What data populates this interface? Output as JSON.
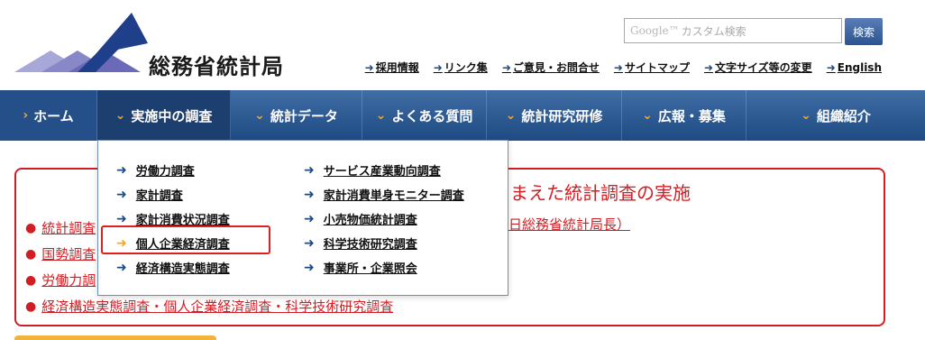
{
  "header": {
    "site_name": "総務省統計局",
    "search_placeholder_brand": "Google™",
    "search_placeholder": "カスタム検索",
    "search_button": "検索",
    "utility_links": [
      {
        "label": "採用情報",
        "icon": "arrow-right-icon"
      },
      {
        "label": "リンク集",
        "icon": "arrow-right-icon"
      },
      {
        "label": "ご意見・お問合せ",
        "icon": "arrow-right-icon"
      },
      {
        "label": "サイトマップ",
        "icon": "arrow-right-icon"
      },
      {
        "label": "文字サイズ等の変更",
        "icon": "arrow-right-icon"
      },
      {
        "label": "English",
        "icon": "arrow-right-icon"
      }
    ]
  },
  "nav": {
    "items": [
      {
        "label": "ホーム",
        "icon": "chevron-right-icon"
      },
      {
        "label": "実施中の調査",
        "icon": "chevron-down-icon"
      },
      {
        "label": "統計データ",
        "icon": "chevron-down-icon"
      },
      {
        "label": "よくある質問",
        "icon": "chevron-down-icon"
      },
      {
        "label": "統計研究研修",
        "icon": "chevron-down-icon"
      },
      {
        "label": "広報・募集",
        "icon": "chevron-down-icon"
      },
      {
        "label": "組織紹介",
        "icon": "chevron-down-icon"
      }
    ]
  },
  "dropdown": {
    "left": [
      "労働力調査",
      "家計調査",
      "家計消費状況調査",
      "個人企業経済調査",
      "経済構造実態調査"
    ],
    "right": [
      "サービス産業動向調査",
      "家計消費単身モニター調査",
      "小売物価統計調査",
      "科学技術研究調査",
      "事業所・企業照会"
    ],
    "highlighted": "個人企業経済調査"
  },
  "notice": {
    "title_visible": "まえた統計調査の実施",
    "items": [
      "統計調査",
      "国勢調査",
      "労働力調",
      "経済構造実態調査・個人企業経済調査・科学技術研究調査"
    ],
    "right_text": "日総務省統計局長）"
  },
  "colors": {
    "nav_blue": "#2a5492",
    "accent_orange": "#f5a623",
    "notice_red": "#d11e24"
  }
}
